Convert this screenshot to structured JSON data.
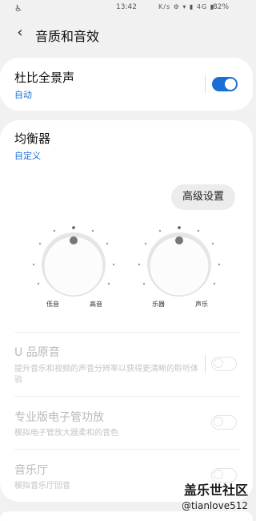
{
  "status": {
    "time": "13:42",
    "icons": "K/s ⚙ ▾ ▮ 4G ▮",
    "battery": "82%"
  },
  "header": {
    "back_icon": "‹",
    "title": "音质和音效"
  },
  "dolby": {
    "title": "杜比全景声",
    "subtitle": "自动",
    "enabled": true
  },
  "equalizer": {
    "title": "均衡器",
    "subtitle": "自定义",
    "advanced_button": "高级设置",
    "knob1": {
      "min_label": "低音",
      "max_label": "高音"
    },
    "knob2": {
      "min_label": "乐器",
      "max_label": "声乐"
    }
  },
  "uhq": {
    "title": "U 品原音",
    "subtitle": "提升音乐和视频的声音分辨率以获得更清晰的聆听体验",
    "enabled": false
  },
  "tube_amp": {
    "title": "专业版电子管功放",
    "subtitle": "模拟电子管放大器柔和的音色",
    "enabled": false
  },
  "concert_hall": {
    "title": "音乐厅",
    "subtitle": "模拟音乐厅回音",
    "enabled": false
  },
  "watermark": {
    "line1": "盖乐世社区",
    "line2": "@tianlove512"
  },
  "colors": {
    "accent": "#1a6fd6",
    "background": "#f1f1f1",
    "card": "#ffffff"
  }
}
